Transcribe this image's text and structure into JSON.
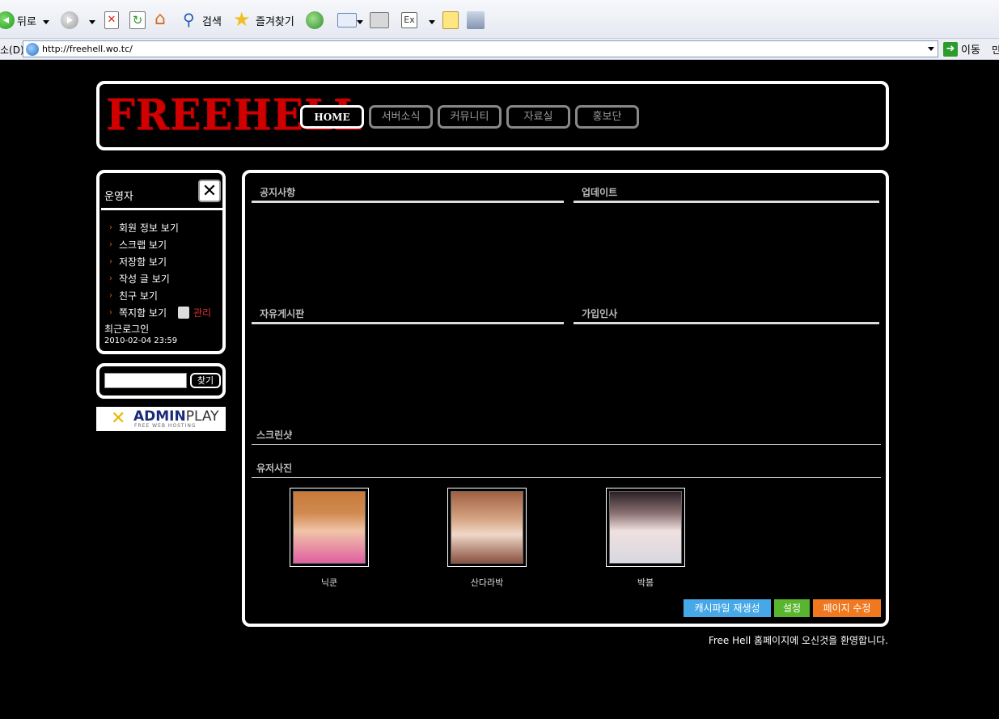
{
  "browser": {
    "toolbar": {
      "back_label": "뒤로",
      "search_label": "검색",
      "favorites_label": "즐겨찾기",
      "edit_icon_text": "Ex"
    },
    "address": {
      "label": "소(D)",
      "url": "http://freehell.wo.tc/",
      "go_label": "이동",
      "links_stub": "민"
    }
  },
  "header": {
    "logo": "FREEHELL",
    "nav": [
      {
        "label": "HOME",
        "active": true
      },
      {
        "label": "서버소식"
      },
      {
        "label": "커뮤니티"
      },
      {
        "label": "자료실"
      },
      {
        "label": "홍보단"
      }
    ]
  },
  "sidebar": {
    "title": "운영자",
    "close_glyph": "✕",
    "menu": [
      "회원 정보 보기",
      "스크랩 보기",
      "저장함 보기",
      "작성 글 보기",
      "친구 보기",
      "쪽지함 보기"
    ],
    "manage_label": "관리",
    "last_login_label": "최근로그인",
    "last_login_time": "2010-02-04 23:59"
  },
  "search": {
    "button_label": "찾기",
    "value": ""
  },
  "banner": {
    "brand_bold": "ADMIN",
    "brand_light": "PLAY",
    "tagline": "FREE WEB HOSTING"
  },
  "content": {
    "sections": {
      "notice": "공지사항",
      "update": "업데이트",
      "free_board": "자유게시판",
      "greetings": "가입인사",
      "screenshot": "스크린샷",
      "user_photos": "유저사진"
    },
    "photos": [
      {
        "name": "닉쿤"
      },
      {
        "name": "산다라박"
      },
      {
        "name": "박봄"
      }
    ],
    "buttons": {
      "cache": "캐시파일 재생성",
      "settings": "설정",
      "edit_page": "페이지 수정"
    }
  },
  "footer": {
    "message": "Free Hell 홈페이지에 오신것을 환영합니다."
  },
  "colors": {
    "background": "#000000",
    "logo_red": "#d00000",
    "menu_arrow": "#e06010",
    "manage_red": "#e03030",
    "btn_cache": "#47a8e8",
    "btn_settings": "#5ab52e",
    "btn_edit": "#f0781e"
  }
}
